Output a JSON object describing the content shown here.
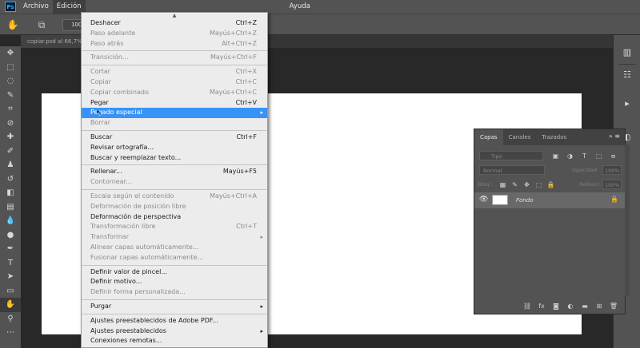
{
  "menubar": {
    "logo": "Ps",
    "items": [
      "Archivo",
      "Edición",
      "",
      "",
      "",
      "",
      "",
      "",
      "Ayuda"
    ]
  },
  "options": {
    "zoom": "100"
  },
  "document": {
    "tab_title": "copiar.psd al 66,7%"
  },
  "edit_menu": {
    "items": [
      {
        "label": "Deshacer",
        "shortcut": "Ctrl+Z",
        "enabled": true
      },
      {
        "label": "Paso adelante",
        "shortcut": "Mayús+Ctrl+Z",
        "enabled": false
      },
      {
        "label": "Paso atrás",
        "shortcut": "Alt+Ctrl+Z",
        "enabled": false
      },
      {
        "sep": true
      },
      {
        "label": "Transición...",
        "shortcut": "Mayús+Ctrl+F",
        "enabled": false
      },
      {
        "sep": true
      },
      {
        "label": "Cortar",
        "shortcut": "Ctrl+X",
        "enabled": false
      },
      {
        "label": "Copiar",
        "shortcut": "Ctrl+C",
        "enabled": false
      },
      {
        "label": "Copiar combinado",
        "shortcut": "Mayús+Ctrl+C",
        "enabled": false
      },
      {
        "label": "Pegar",
        "shortcut": "Ctrl+V",
        "enabled": true
      },
      {
        "label": "Pegado especial",
        "shortcut": "",
        "enabled": true,
        "submenu": true,
        "highlighted": true
      },
      {
        "label": "Borrar",
        "shortcut": "",
        "enabled": false
      },
      {
        "sep": true
      },
      {
        "label": "Buscar",
        "shortcut": "Ctrl+F",
        "enabled": true
      },
      {
        "label": "Revisar ortografía...",
        "shortcut": "",
        "enabled": true
      },
      {
        "label": "Buscar y reemplazar texto...",
        "shortcut": "",
        "enabled": true
      },
      {
        "sep": true
      },
      {
        "label": "Rellenar...",
        "shortcut": "Mayús+F5",
        "enabled": true
      },
      {
        "label": "Contornear...",
        "shortcut": "",
        "enabled": false
      },
      {
        "sep": true
      },
      {
        "label": "Escala según el contenido",
        "shortcut": "Mayús+Ctrl+A",
        "enabled": false
      },
      {
        "label": "Deformación de posición libre",
        "shortcut": "",
        "enabled": false
      },
      {
        "label": "Deformación de perspectiva",
        "shortcut": "",
        "enabled": true
      },
      {
        "label": "Transformación libre",
        "shortcut": "Ctrl+T",
        "enabled": false
      },
      {
        "label": "Transformar",
        "shortcut": "",
        "enabled": false,
        "submenu": true
      },
      {
        "label": "Alinear capas automáticamente...",
        "shortcut": "",
        "enabled": false
      },
      {
        "label": "Fusionar capas automáticamente...",
        "shortcut": "",
        "enabled": false
      },
      {
        "sep": true
      },
      {
        "label": "Definir valor de pincel...",
        "shortcut": "",
        "enabled": true
      },
      {
        "label": "Definir motivo...",
        "shortcut": "",
        "enabled": true
      },
      {
        "label": "Definir forma personalizada...",
        "shortcut": "",
        "enabled": false
      },
      {
        "sep": true
      },
      {
        "label": "Purgar",
        "shortcut": "",
        "enabled": true,
        "submenu": true
      },
      {
        "sep": true
      },
      {
        "label": "Ajustes preestablecidos de Adobe PDF...",
        "shortcut": "",
        "enabled": true
      },
      {
        "label": "Ajustes preestablecidos",
        "shortcut": "",
        "enabled": true,
        "submenu": true
      },
      {
        "label": "Conexiones remotas...",
        "shortcut": "",
        "enabled": true
      }
    ]
  },
  "layers_panel": {
    "tabs": [
      "Capas",
      "Canales",
      "Trazados"
    ],
    "filter_placeholder": "Tipo",
    "blend_mode": "Normal",
    "opacity_label": "Opacidad:",
    "opacity_value": "100%",
    "lock_label": "Bloq.:",
    "fill_label": "Relleno:",
    "fill_value": "100%",
    "layer_name": "Fondo",
    "footer_fx": "fx"
  }
}
